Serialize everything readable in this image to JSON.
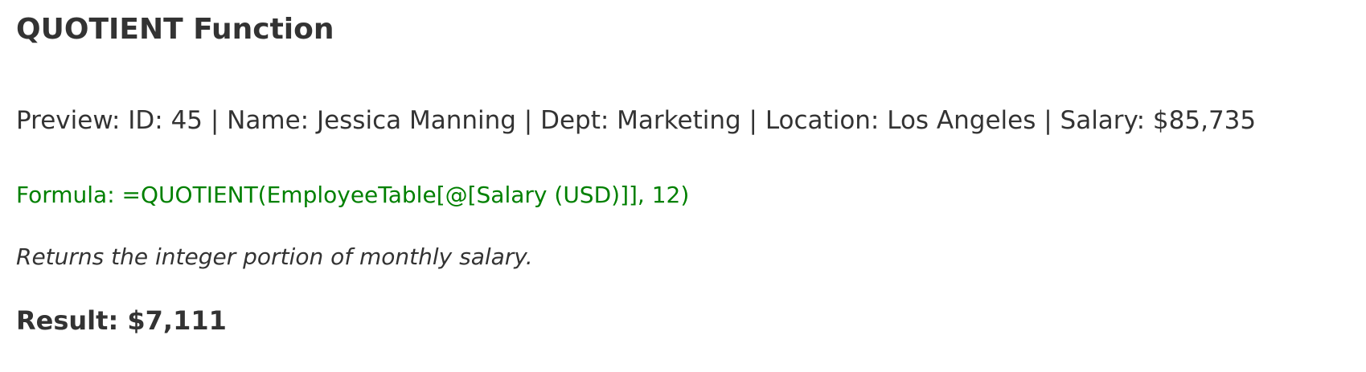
{
  "title": "QUOTIENT Function",
  "preview": "Preview: ID: 45 | Name: Jessica Manning | Dept: Marketing | Location: Los Angeles | Salary: $85,735",
  "formula": "Formula: =QUOTIENT(EmployeeTable[@[Salary (USD)]], 12)",
  "description": "Returns the integer portion of monthly salary.",
  "result": "Result: $7,111",
  "colors": {
    "text": "#333333",
    "formula": "#008000",
    "background": "#ffffff"
  }
}
